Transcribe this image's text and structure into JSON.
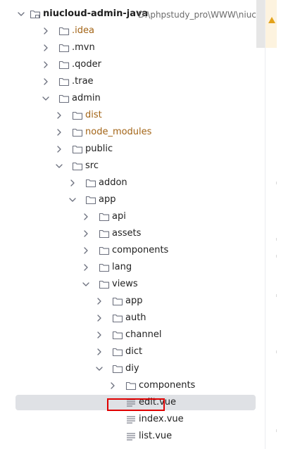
{
  "project": {
    "name": "niucloud-admin-java",
    "path": "D:\\phpstudy_pro\\WWW\\niuclo"
  },
  "tree": [
    {
      "label": "niucloud-admin-java",
      "type": "project",
      "expanded": true,
      "level": 0
    },
    {
      "label": ".idea",
      "type": "folder",
      "expanded": false,
      "level": 1,
      "excluded": true
    },
    {
      "label": ".mvn",
      "type": "folder",
      "expanded": false,
      "level": 1
    },
    {
      "label": ".qoder",
      "type": "folder",
      "expanded": false,
      "level": 1
    },
    {
      "label": ".trae",
      "type": "folder",
      "expanded": false,
      "level": 1
    },
    {
      "label": "admin",
      "type": "folder",
      "expanded": true,
      "level": 1
    },
    {
      "label": "dist",
      "type": "folder",
      "expanded": false,
      "level": 2,
      "excluded": true
    },
    {
      "label": "node_modules",
      "type": "folder",
      "expanded": false,
      "level": 2,
      "excluded": true
    },
    {
      "label": "public",
      "type": "folder",
      "expanded": false,
      "level": 2
    },
    {
      "label": "src",
      "type": "folder",
      "expanded": true,
      "level": 2
    },
    {
      "label": "addon",
      "type": "folder",
      "expanded": false,
      "level": 3
    },
    {
      "label": "app",
      "type": "folder",
      "expanded": true,
      "level": 3
    },
    {
      "label": "api",
      "type": "folder",
      "expanded": false,
      "level": 4
    },
    {
      "label": "assets",
      "type": "folder",
      "expanded": false,
      "level": 4
    },
    {
      "label": "components",
      "type": "folder",
      "expanded": false,
      "level": 4
    },
    {
      "label": "lang",
      "type": "folder",
      "expanded": false,
      "level": 4
    },
    {
      "label": "views",
      "type": "folder",
      "expanded": true,
      "level": 4
    },
    {
      "label": "app",
      "type": "folder",
      "expanded": false,
      "level": 5
    },
    {
      "label": "auth",
      "type": "folder",
      "expanded": false,
      "level": 5
    },
    {
      "label": "channel",
      "type": "folder",
      "expanded": false,
      "level": 5
    },
    {
      "label": "dict",
      "type": "folder",
      "expanded": false,
      "level": 5
    },
    {
      "label": "diy",
      "type": "folder",
      "expanded": true,
      "level": 5
    },
    {
      "label": "components",
      "type": "folder",
      "expanded": false,
      "level": 6
    },
    {
      "label": "edit.vue",
      "type": "file",
      "level": 6,
      "selected": true
    },
    {
      "label": "index.vue",
      "type": "file",
      "level": 6
    },
    {
      "label": "list.vue",
      "type": "file",
      "level": 6
    }
  ],
  "colors": {
    "folder_stroke": "#6c707e",
    "excluded_text": "#a36416",
    "selection_bg": "#dfe1e5",
    "highlight_border": "#e00000",
    "warning": "#e3a21a"
  },
  "icons": {
    "collapsed": "chevron-right-icon",
    "expanded": "chevron-down-icon",
    "folder": "folder-icon",
    "project": "project-folder-icon",
    "file": "text-file-icon"
  }
}
